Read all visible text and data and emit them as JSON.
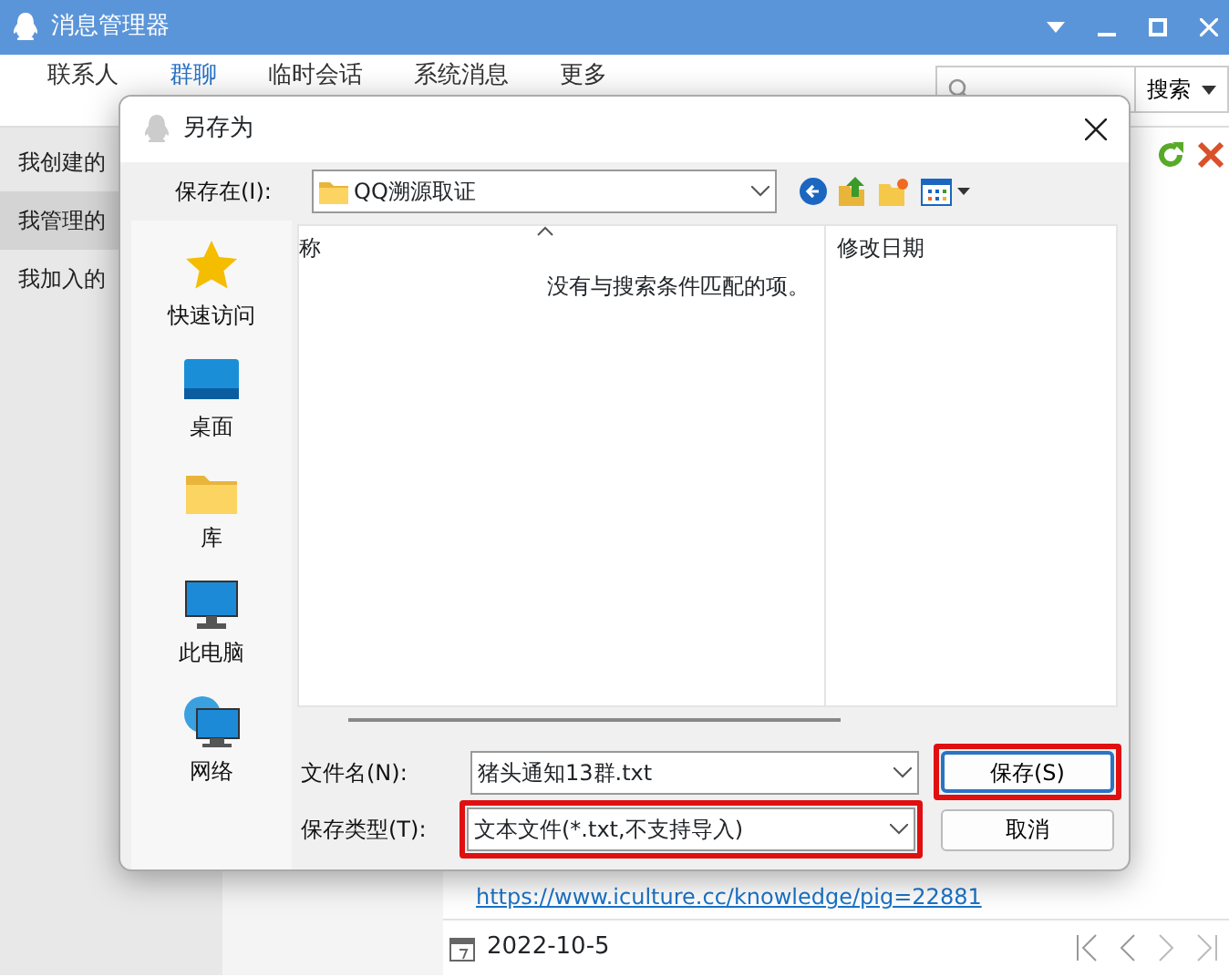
{
  "window": {
    "title": "消息管理器"
  },
  "tabs": [
    {
      "label": "联系人",
      "selected": false
    },
    {
      "label": "群聊",
      "selected": true
    },
    {
      "label": "临时会话",
      "selected": false
    },
    {
      "label": "系统消息",
      "selected": false
    },
    {
      "label": "更多",
      "selected": false
    }
  ],
  "search": {
    "button": "搜索"
  },
  "sidebar": {
    "items": [
      {
        "label": "我创建的",
        "selected": false
      },
      {
        "label": "我管理的",
        "selected": true
      },
      {
        "label": "我加入的",
        "selected": false
      }
    ]
  },
  "message": {
    "link": "https://www.iculture.cc/knowledge/pig=22881"
  },
  "date_bar": {
    "date": "2022-10-5"
  },
  "dialog": {
    "title": "另存为",
    "save_in_label": "保存在(I):",
    "folder": "QQ溯源取证",
    "columns": [
      "称",
      "修改日期"
    ],
    "empty_message": "没有与搜索条件匹配的项。",
    "places": [
      {
        "label": "快速访问"
      },
      {
        "label": "桌面"
      },
      {
        "label": "库"
      },
      {
        "label": "此电脑"
      },
      {
        "label": "网络"
      }
    ],
    "filename_label": "文件名(N):",
    "filename": "猪头通知13群.txt",
    "filetype_label": "保存类型(T):",
    "filetype": "文本文件(*.txt,不支持导入)",
    "filetype_highlighted": true,
    "buttons": [
      {
        "label": "保存(S)",
        "default": true,
        "highlighted": true
      },
      {
        "label": "取消",
        "default": false,
        "highlighted": false
      }
    ]
  }
}
